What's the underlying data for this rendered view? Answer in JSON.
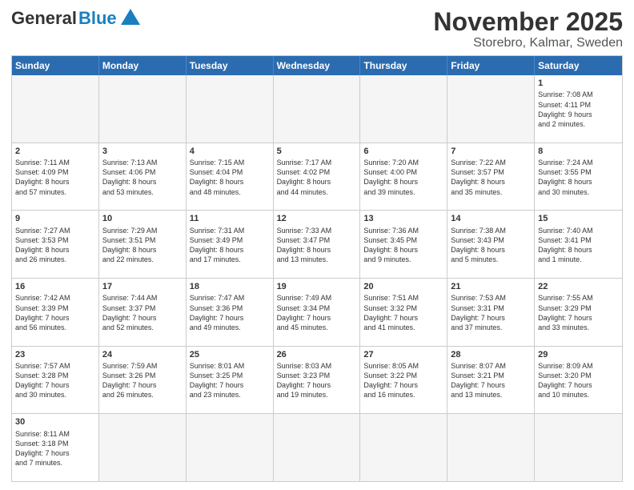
{
  "header": {
    "logo_general": "General",
    "logo_blue": "Blue",
    "month_title": "November 2025",
    "location": "Storebro, Kalmar, Sweden"
  },
  "calendar": {
    "days_of_week": [
      "Sunday",
      "Monday",
      "Tuesday",
      "Wednesday",
      "Thursday",
      "Friday",
      "Saturday"
    ],
    "weeks": [
      [
        {
          "day": "",
          "info": ""
        },
        {
          "day": "",
          "info": ""
        },
        {
          "day": "",
          "info": ""
        },
        {
          "day": "",
          "info": ""
        },
        {
          "day": "",
          "info": ""
        },
        {
          "day": "",
          "info": ""
        },
        {
          "day": "1",
          "info": "Sunrise: 7:08 AM\nSunset: 4:11 PM\nDaylight: 9 hours\nand 2 minutes."
        }
      ],
      [
        {
          "day": "2",
          "info": "Sunrise: 7:11 AM\nSunset: 4:09 PM\nDaylight: 8 hours\nand 57 minutes."
        },
        {
          "day": "3",
          "info": "Sunrise: 7:13 AM\nSunset: 4:06 PM\nDaylight: 8 hours\nand 53 minutes."
        },
        {
          "day": "4",
          "info": "Sunrise: 7:15 AM\nSunset: 4:04 PM\nDaylight: 8 hours\nand 48 minutes."
        },
        {
          "day": "5",
          "info": "Sunrise: 7:17 AM\nSunset: 4:02 PM\nDaylight: 8 hours\nand 44 minutes."
        },
        {
          "day": "6",
          "info": "Sunrise: 7:20 AM\nSunset: 4:00 PM\nDaylight: 8 hours\nand 39 minutes."
        },
        {
          "day": "7",
          "info": "Sunrise: 7:22 AM\nSunset: 3:57 PM\nDaylight: 8 hours\nand 35 minutes."
        },
        {
          "day": "8",
          "info": "Sunrise: 7:24 AM\nSunset: 3:55 PM\nDaylight: 8 hours\nand 30 minutes."
        }
      ],
      [
        {
          "day": "9",
          "info": "Sunrise: 7:27 AM\nSunset: 3:53 PM\nDaylight: 8 hours\nand 26 minutes."
        },
        {
          "day": "10",
          "info": "Sunrise: 7:29 AM\nSunset: 3:51 PM\nDaylight: 8 hours\nand 22 minutes."
        },
        {
          "day": "11",
          "info": "Sunrise: 7:31 AM\nSunset: 3:49 PM\nDaylight: 8 hours\nand 17 minutes."
        },
        {
          "day": "12",
          "info": "Sunrise: 7:33 AM\nSunset: 3:47 PM\nDaylight: 8 hours\nand 13 minutes."
        },
        {
          "day": "13",
          "info": "Sunrise: 7:36 AM\nSunset: 3:45 PM\nDaylight: 8 hours\nand 9 minutes."
        },
        {
          "day": "14",
          "info": "Sunrise: 7:38 AM\nSunset: 3:43 PM\nDaylight: 8 hours\nand 5 minutes."
        },
        {
          "day": "15",
          "info": "Sunrise: 7:40 AM\nSunset: 3:41 PM\nDaylight: 8 hours\nand 1 minute."
        }
      ],
      [
        {
          "day": "16",
          "info": "Sunrise: 7:42 AM\nSunset: 3:39 PM\nDaylight: 7 hours\nand 56 minutes."
        },
        {
          "day": "17",
          "info": "Sunrise: 7:44 AM\nSunset: 3:37 PM\nDaylight: 7 hours\nand 52 minutes."
        },
        {
          "day": "18",
          "info": "Sunrise: 7:47 AM\nSunset: 3:36 PM\nDaylight: 7 hours\nand 49 minutes."
        },
        {
          "day": "19",
          "info": "Sunrise: 7:49 AM\nSunset: 3:34 PM\nDaylight: 7 hours\nand 45 minutes."
        },
        {
          "day": "20",
          "info": "Sunrise: 7:51 AM\nSunset: 3:32 PM\nDaylight: 7 hours\nand 41 minutes."
        },
        {
          "day": "21",
          "info": "Sunrise: 7:53 AM\nSunset: 3:31 PM\nDaylight: 7 hours\nand 37 minutes."
        },
        {
          "day": "22",
          "info": "Sunrise: 7:55 AM\nSunset: 3:29 PM\nDaylight: 7 hours\nand 33 minutes."
        }
      ],
      [
        {
          "day": "23",
          "info": "Sunrise: 7:57 AM\nSunset: 3:28 PM\nDaylight: 7 hours\nand 30 minutes."
        },
        {
          "day": "24",
          "info": "Sunrise: 7:59 AM\nSunset: 3:26 PM\nDaylight: 7 hours\nand 26 minutes."
        },
        {
          "day": "25",
          "info": "Sunrise: 8:01 AM\nSunset: 3:25 PM\nDaylight: 7 hours\nand 23 minutes."
        },
        {
          "day": "26",
          "info": "Sunrise: 8:03 AM\nSunset: 3:23 PM\nDaylight: 7 hours\nand 19 minutes."
        },
        {
          "day": "27",
          "info": "Sunrise: 8:05 AM\nSunset: 3:22 PM\nDaylight: 7 hours\nand 16 minutes."
        },
        {
          "day": "28",
          "info": "Sunrise: 8:07 AM\nSunset: 3:21 PM\nDaylight: 7 hours\nand 13 minutes."
        },
        {
          "day": "29",
          "info": "Sunrise: 8:09 AM\nSunset: 3:20 PM\nDaylight: 7 hours\nand 10 minutes."
        }
      ],
      [
        {
          "day": "30",
          "info": "Sunrise: 8:11 AM\nSunset: 3:18 PM\nDaylight: 7 hours\nand 7 minutes."
        },
        {
          "day": "",
          "info": ""
        },
        {
          "day": "",
          "info": ""
        },
        {
          "day": "",
          "info": ""
        },
        {
          "day": "",
          "info": ""
        },
        {
          "day": "",
          "info": ""
        },
        {
          "day": "",
          "info": ""
        }
      ]
    ]
  }
}
